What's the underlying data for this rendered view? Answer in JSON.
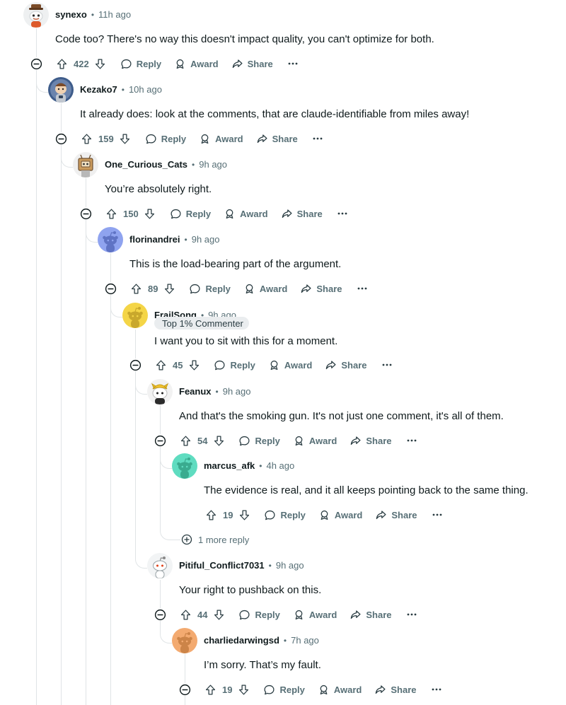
{
  "thread": {
    "actions": {
      "reply": "Reply",
      "award": "Award",
      "share": "Share"
    },
    "flair_text": "Top 1% Commenter",
    "more_replies_label": "1 more reply",
    "comments": [
      {
        "username": "synexo",
        "time": "11h ago",
        "body": "Code too? There's no way this doesn't impact quality, you can't optimize for both.",
        "score": "422",
        "avatar": "synexo"
      },
      {
        "username": "Kezako7",
        "time": "10h ago",
        "body": "It already does: look at the comments, that are claude-identifiable from miles away!",
        "score": "159",
        "avatar": "kezako7"
      },
      {
        "username": "One_Curious_Cats",
        "time": "9h ago",
        "body": "You’re absolutely right.",
        "score": "150",
        "avatar": "box-robot"
      },
      {
        "username": "florinandrei",
        "time": "9h ago",
        "body": "This is the load-bearing part of the argument.",
        "score": "89",
        "avatar": "snoo-default",
        "avatar_bg": "#8fa3ef",
        "avatar_fg": "#5f73c4"
      },
      {
        "username": "FrailSong",
        "time": "9h ago",
        "body": "I want you to sit with this for a moment.",
        "score": "45",
        "avatar": "snoo-default",
        "avatar_bg": "#f4d547",
        "avatar_fg": "#c9a82c"
      },
      {
        "username": "Feanux",
        "time": "9h ago",
        "body": "And that's the smoking gun. It's not just one comment, it's all of them.",
        "score": "54",
        "avatar": "snoo-costume"
      },
      {
        "username": "marcus_afk",
        "time": "4h ago",
        "body": "The evidence is real, and it all keeps pointing back to the same thing.",
        "score": "19",
        "avatar": "snoo-default",
        "avatar_bg": "#5fdcc0",
        "avatar_fg": "#3aab8f"
      },
      {
        "username": "Pitiful_Conflict7031",
        "time": "9h ago",
        "body": "Your right to pushback on this.",
        "score": "44",
        "avatar": "snoo-white"
      },
      {
        "username": "charliedarwingsd",
        "time": "7h ago",
        "body": "I’m sorry. That’s my fault.",
        "score": "19",
        "avatar": "snoo-default",
        "avatar_bg": "#f3aa70",
        "avatar_fg": "#cc8448"
      }
    ]
  }
}
